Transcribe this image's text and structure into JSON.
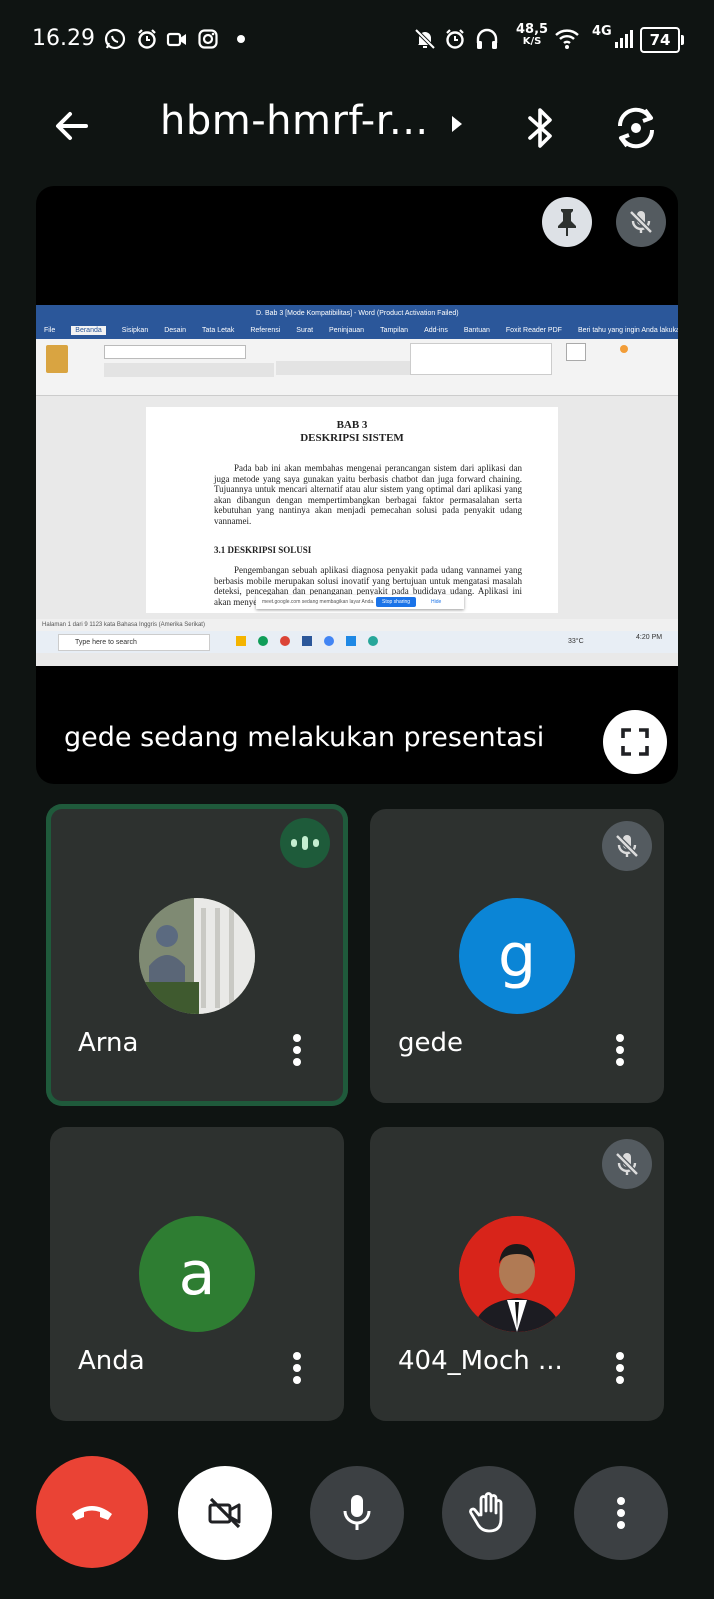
{
  "status_bar": {
    "time": "16.29",
    "net_speed_value": "48,5",
    "net_speed_unit": "K/S",
    "network": "4G",
    "battery": "74"
  },
  "header": {
    "meeting_code": "hbm-hmrf-r..."
  },
  "presentation": {
    "label": "gede sedang melakukan presentasi",
    "document": {
      "window_title": "D. Bab 3 [Mode Kompatibilitas] - Word (Product Activation Failed)",
      "tabs": [
        "File",
        "Beranda",
        "Sisipkan",
        "Desain",
        "Tata Letak",
        "Referensi",
        "Surat",
        "Peninjauan",
        "Tampilan",
        "Add-ins",
        "Bantuan",
        "Foxit Reader PDF",
        "Beri tahu yang ingin Anda lakukan"
      ],
      "heading1": "BAB 3",
      "heading2": "DESKRIPSI SISTEM",
      "para1": "Pada bab ini akan membahas mengenai perancangan sistem dari aplikasi dan juga metode yang saya gunakan yaitu berbasis chatbot dan juga forward chaining. Tujuannya untuk mencari alternatif atau alur sistem yang optimal dari aplikasi yang akan dibangun dengan mempertimbangkan berbagai faktor permasalahan serta kebutuhan yang nantinya akan menjadi pemecahan solusi pada penyakit udang vannamei.",
      "section": "3.1   DESKRIPSI SOLUSI",
      "para2": "Pengembangan sebuah aplikasi diagnosa penyakit pada udang vannamei yang berbasis mobile merupakan solusi inovatif yang bertujuan untuk mengatasi masalah deteksi, pencegahan dan penanganan penyakit pada budidaya udang. Aplikasi ini akan menyediakan",
      "share_bar": "meet.google.com sedang membagikan layar Anda.",
      "share_stop": "Stop sharing",
      "share_hide": "Hide",
      "status_left": "Halaman 1 dari 9    1123 kata    Bahasa Inggris (Amerika Serikat)",
      "taskbar_search": "Type here to search",
      "weather": "33°C",
      "clock": "4:20 PM"
    }
  },
  "participants": [
    {
      "name": "Arna",
      "initial": "",
      "speaking": true,
      "muted": false
    },
    {
      "name": "gede",
      "initial": "g",
      "speaking": false,
      "muted": true,
      "color": "#0b85d6"
    },
    {
      "name": "Anda",
      "initial": "a",
      "speaking": false,
      "muted": false,
      "color": "#2e7d32"
    },
    {
      "name": "404_Moch ...",
      "initial": "",
      "speaking": false,
      "muted": true
    }
  ],
  "colors": {
    "end_call": "#ea4335",
    "speaking_border": "#1f5a3b",
    "tile_bg": "#2d312f"
  }
}
